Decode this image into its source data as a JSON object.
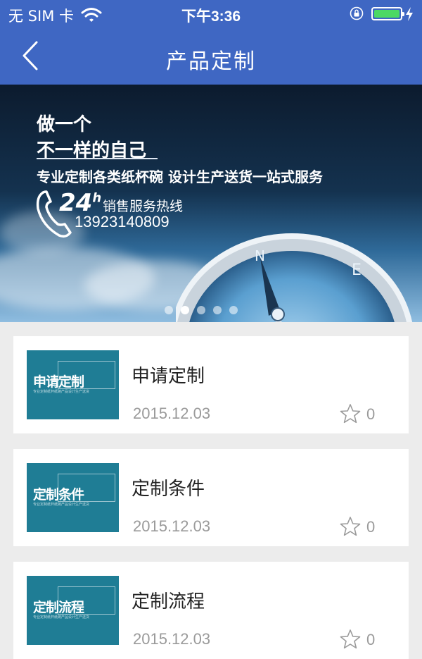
{
  "status_bar": {
    "carrier": "无 SIM 卡",
    "time": "下午3:36",
    "battery_level": 1.0
  },
  "nav": {
    "title": "产品定制",
    "back_icon": "chevron-left-icon"
  },
  "banner": {
    "slogan_line1": "做一个",
    "slogan_line2": "不一样的自己",
    "services": "专业定制各类纸杯碗  设计生产送货一站式服务",
    "hours": "24",
    "hours_sup": "h",
    "hotline_label": "销售服务热线",
    "hotline": "13923140809",
    "slides": 5,
    "active_slide": 1
  },
  "items": [
    {
      "thumb_title": "申请定制",
      "thumb_sub": "专业定制纸杯纸碗产品设计生产送货",
      "name": "申请定制",
      "date": "2015.12.03",
      "favorites": "0"
    },
    {
      "thumb_title": "定制条件",
      "thumb_sub": "专业定制纸杯纸碗产品设计生产送货",
      "name": "定制条件",
      "date": "2015.12.03",
      "favorites": "0"
    },
    {
      "thumb_title": "定制流程",
      "thumb_sub": "专业定制纸杯纸碗产品设计生产送货",
      "name": "定制流程",
      "date": "2015.12.03",
      "favorites": "0"
    }
  ],
  "colors": {
    "nav_bg": "#3f67c3",
    "thumb_bg": "#1f7d95",
    "battery": "#4cd964"
  }
}
